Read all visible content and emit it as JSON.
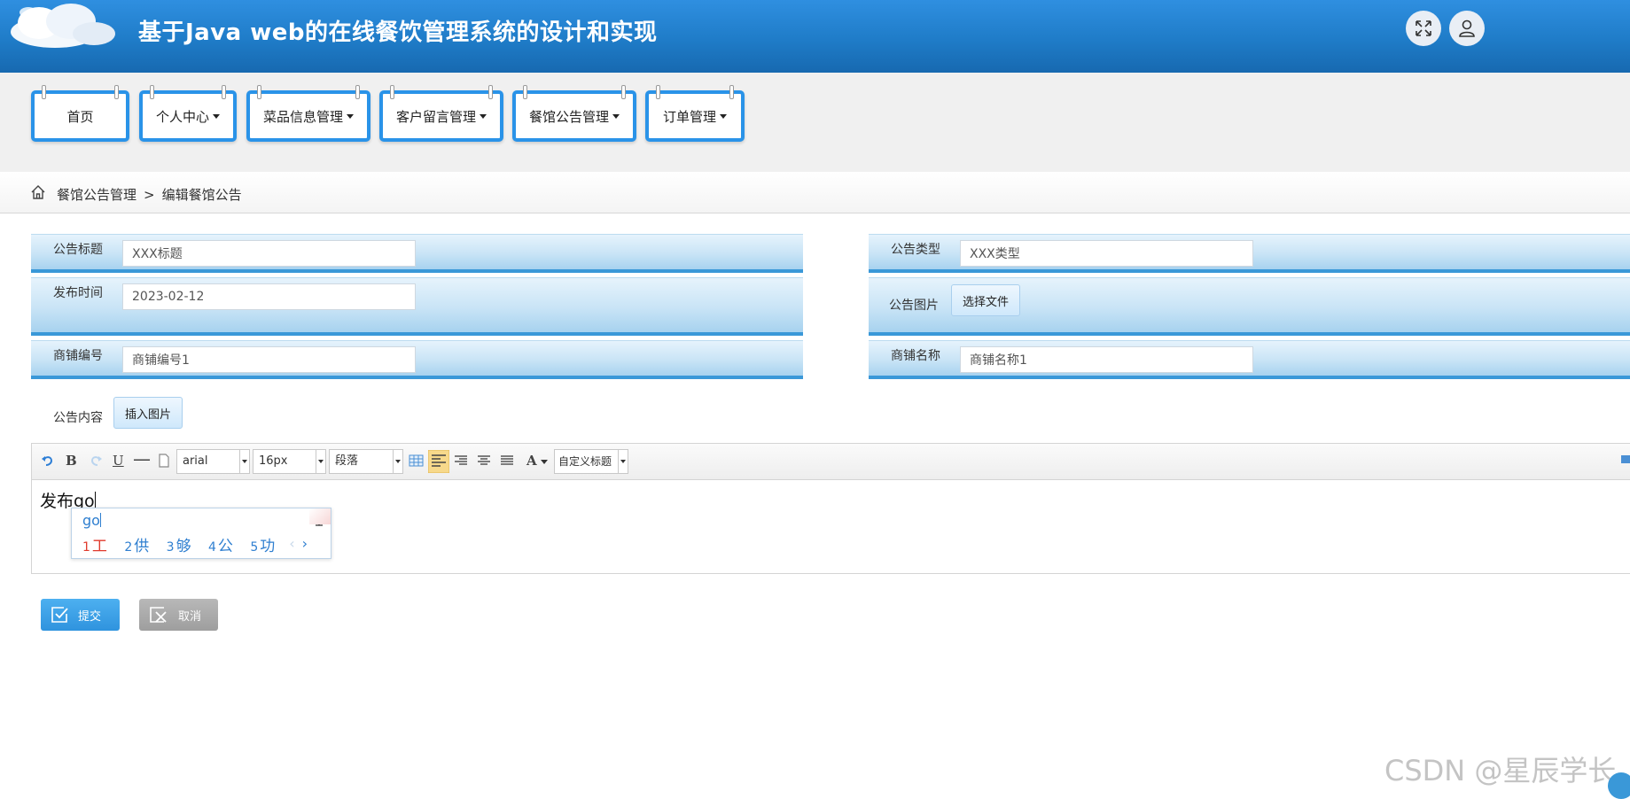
{
  "header": {
    "title": "基于Java web的在线餐饮管理系统的设计和实现",
    "icons": [
      "fullscreen-icon",
      "user-icon"
    ]
  },
  "nav": {
    "items": [
      {
        "label": "首页",
        "dropdown": false
      },
      {
        "label": "个人中心",
        "dropdown": true
      },
      {
        "label": "菜品信息管理",
        "dropdown": true
      },
      {
        "label": "客户留言管理",
        "dropdown": true
      },
      {
        "label": "餐馆公告管理",
        "dropdown": true
      },
      {
        "label": "订单管理",
        "dropdown": true
      }
    ]
  },
  "breadcrumb": {
    "parent": "餐馆公告管理",
    "separator": ">",
    "current": "编辑餐馆公告"
  },
  "form": {
    "title_label": "公告标题",
    "title_value": "XXX标题",
    "type_label": "公告类型",
    "type_value": "XXX类型",
    "time_label": "发布时间",
    "time_value": "2023-02-12",
    "image_label": "公告图片",
    "image_button": "选择文件",
    "shop_no_label": "商铺编号",
    "shop_no_value": "商铺编号1",
    "shop_name_label": "商铺名称",
    "shop_name_value": "商铺名称1",
    "content_label": "公告内容",
    "insert_image_button": "插入图片"
  },
  "editor": {
    "font_family": "arial",
    "font_size": "16px",
    "paragraph": "段落",
    "custom_heading": "自定义标题",
    "font_color_label": "A",
    "content_text": "发布go"
  },
  "ime": {
    "input": "go",
    "candidates": [
      {
        "num": "1",
        "char": "工"
      },
      {
        "num": "2",
        "char": "供"
      },
      {
        "num": "3",
        "char": "够"
      },
      {
        "num": "4",
        "char": "公"
      },
      {
        "num": "5",
        "char": "功"
      }
    ],
    "prev": "‹",
    "next": "›"
  },
  "actions": {
    "submit_label": "提交",
    "cancel_label": "取消"
  },
  "watermark": "CSDN @星辰学长",
  "colors": {
    "header_blue": "#1f7cc8",
    "nav_border": "#2a93e8",
    "submit_bg": "#3aa0e8",
    "cancel_bg": "#a8a8a8",
    "ime_highlight": "#e03a2c"
  }
}
